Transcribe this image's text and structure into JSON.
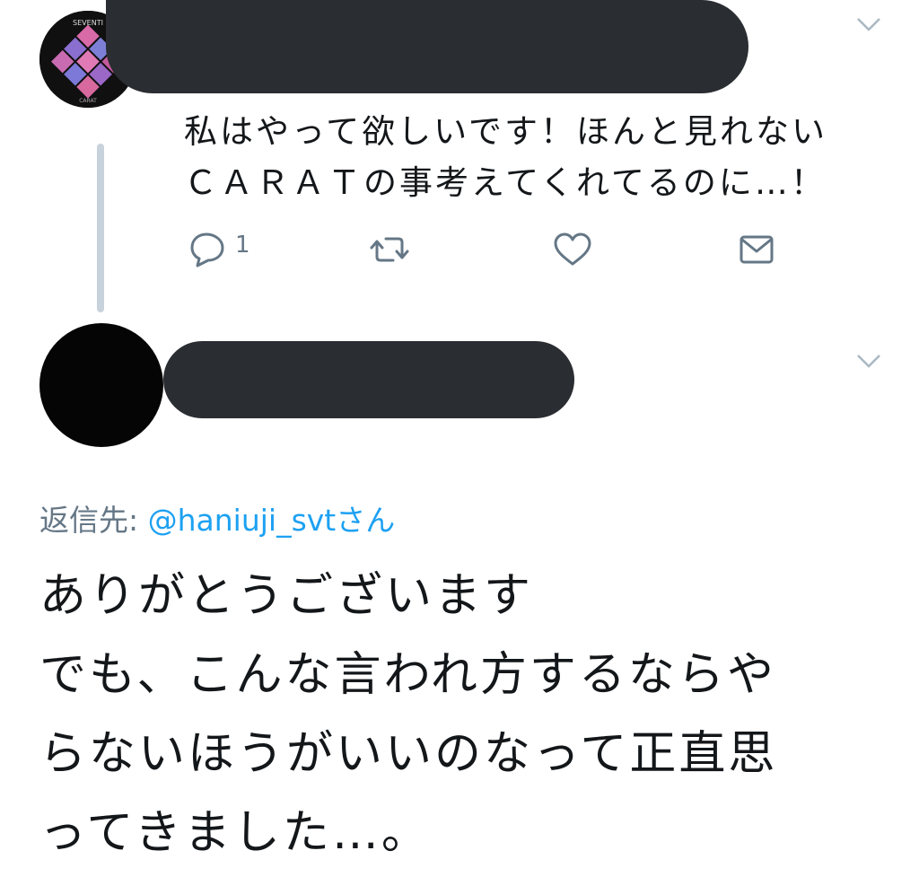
{
  "tweet1": {
    "avatar": {
      "top_text": "SEVENTI",
      "bottom_text": "CARAT"
    },
    "text_lines": [
      "私はやって欲しいです！ほんと見れない",
      "ＣＡＲＡＴの事考えてくれてるのに…！"
    ],
    "actions": {
      "reply_count": "1"
    }
  },
  "tweet2": {
    "reply_label": "返信先: ",
    "reply_handle": "@haniuji_svt",
    "reply_suffix": "さん",
    "text_lines": [
      "ありがとうございます",
      "でも、こんな言われ方するならや",
      "らないほうがいいのなって正直思",
      "ってきました…。"
    ]
  },
  "colors": {
    "text": "#14171a",
    "secondary": "#657786",
    "link": "#1da1f2",
    "thread_line": "#c7d2dc",
    "redaction": "#2a2d31"
  },
  "icons": [
    "reply-icon",
    "retweet-icon",
    "like-icon",
    "dm-icon",
    "chevron-down-icon"
  ]
}
